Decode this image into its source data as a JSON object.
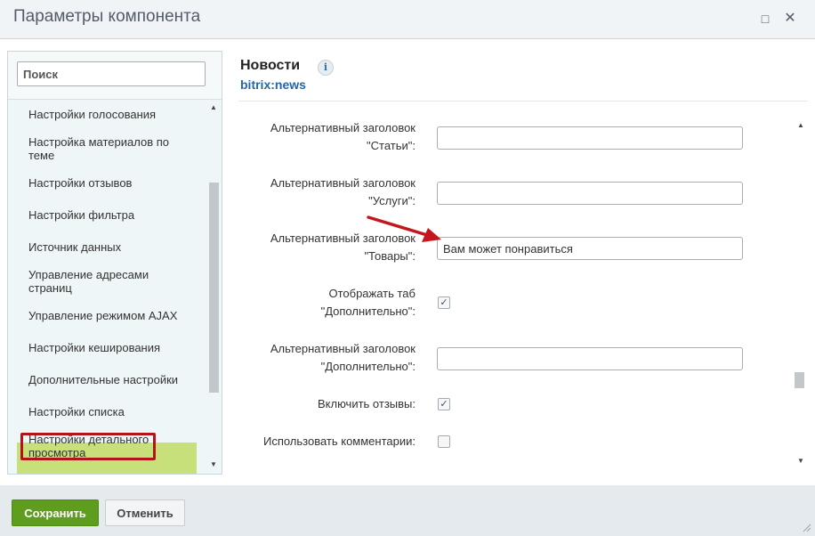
{
  "window": {
    "title": "Параметры компонента",
    "maximize_icon": "□",
    "close_icon": "✕"
  },
  "sidebar": {
    "search_placeholder": "Поиск",
    "items": [
      {
        "label": "Настройки голосования"
      },
      {
        "label": "Настройка материалов по теме"
      },
      {
        "label": "Настройки отзывов"
      },
      {
        "label": "Настройки фильтра"
      },
      {
        "label": "Источник данных"
      },
      {
        "label": "Управление адресами страниц"
      },
      {
        "label": "Управление режимом AJAX"
      },
      {
        "label": "Настройки кеширования"
      },
      {
        "label": "Дополнительные настройки"
      },
      {
        "label": "Настройки списка"
      },
      {
        "label": "Настройки детального просмотра",
        "active": true
      }
    ]
  },
  "component": {
    "title": "Новости",
    "code": "bitrix:news",
    "info_icon": "i"
  },
  "form": {
    "fields": [
      {
        "label_line1": "Альтернативный заголовок",
        "label_line2": "\"Статьи\":",
        "type": "text",
        "value": ""
      },
      {
        "label_line1": "Альтернативный заголовок",
        "label_line2": "\"Услуги\":",
        "type": "text",
        "value": ""
      },
      {
        "label_line1": "Альтернативный заголовок",
        "label_line2": "\"Товары\":",
        "type": "text",
        "value": "Вам может понравиться"
      },
      {
        "label_line1": "Отображать таб",
        "label_line2": "\"Дополнительно\":",
        "type": "checkbox",
        "checked": true
      },
      {
        "label_line1": "Альтернативный заголовок",
        "label_line2": "\"Дополнительно\":",
        "type": "text",
        "value": ""
      },
      {
        "label_line1": "Включить отзывы:",
        "type": "checkbox",
        "checked": true
      },
      {
        "label_line1": "Использовать комментарии:",
        "type": "checkbox",
        "checked": false
      }
    ]
  },
  "footer": {
    "save_label": "Сохранить",
    "cancel_label": "Отменить"
  },
  "colors": {
    "accent_green": "#5f9d1f",
    "highlight_red": "#b3141a",
    "active_item": "#c8e07a",
    "link_blue": "#2067b0"
  }
}
